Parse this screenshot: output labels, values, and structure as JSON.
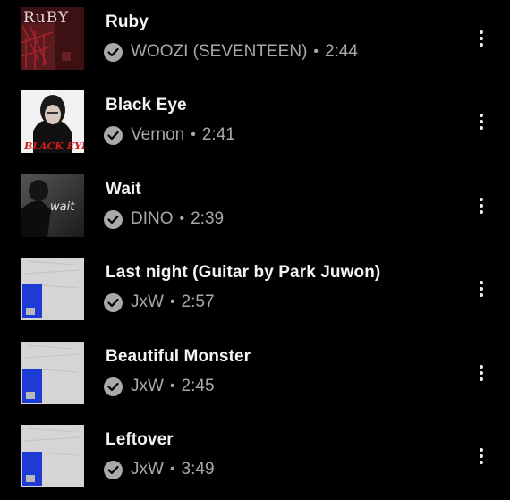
{
  "tracks": [
    {
      "title": "Ruby",
      "artist": "WOOZI (SEVENTEEN)",
      "duration": "2:44",
      "art": "ruby-album-art",
      "art_text": "RuBY"
    },
    {
      "title": "Black Eye",
      "artist": "Vernon",
      "duration": "2:41",
      "art": "black-eye-album-art",
      "art_text": "BLACK EYE"
    },
    {
      "title": "Wait",
      "artist": "DINO",
      "duration": "2:39",
      "art": "wait-album-art",
      "art_text": "wait"
    },
    {
      "title": "Last night (Guitar by Park Juwon)",
      "artist": "JxW",
      "duration": "2:57",
      "art": "jxw-album-art"
    },
    {
      "title": "Beautiful Monster",
      "artist": "JxW",
      "duration": "2:45",
      "art": "jxw-album-art"
    },
    {
      "title": "Leftover",
      "artist": "JxW",
      "duration": "3:49",
      "art": "jxw-album-art"
    }
  ],
  "separator": "•",
  "icons": {
    "verified": "check-circle-icon",
    "more": "more-vertical-icon"
  },
  "colors": {
    "background": "#000000",
    "title": "#f4f4f4",
    "meta": "#a9a9a9"
  }
}
